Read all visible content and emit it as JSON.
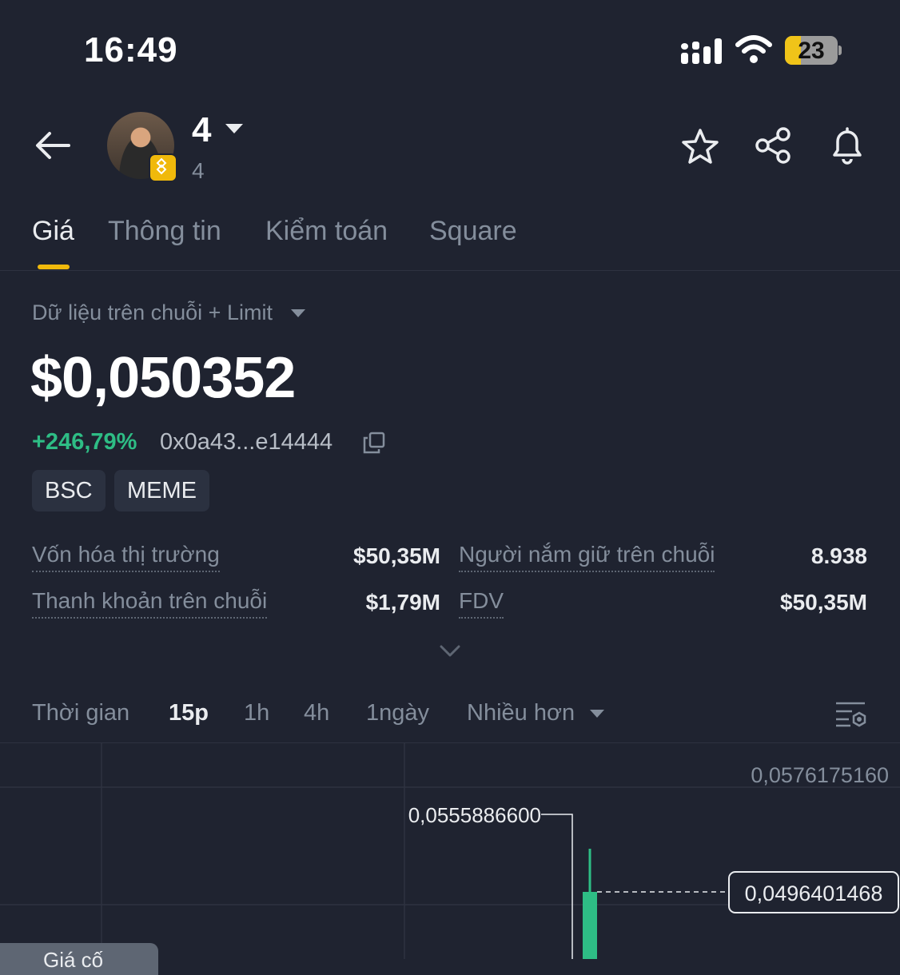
{
  "status_bar": {
    "time": "16:49",
    "battery": "23"
  },
  "header": {
    "token_name": "4",
    "token_subtitle": "4"
  },
  "tabs": [
    {
      "label": "Giá",
      "active": true
    },
    {
      "label": "Thông tin",
      "active": false
    },
    {
      "label": "Kiểm toán",
      "active": false
    },
    {
      "label": "Square",
      "active": false
    }
  ],
  "price_section": {
    "source": "Dữ liệu trên chuỗi + Limit",
    "price": "$0,050352",
    "change": "+246,79%",
    "address": "0x0a43...e14444",
    "tags": [
      "BSC",
      "MEME"
    ]
  },
  "stats": [
    {
      "label": "Vốn hóa thị trường",
      "value": "$50,35M"
    },
    {
      "label": "Người nắm giữ trên chuỗi",
      "value": "8.938"
    },
    {
      "label": "Thanh khoản trên chuỗi",
      "value": "$1,79M"
    },
    {
      "label": "FDV",
      "value": "$50,35M"
    }
  ],
  "timeframes": {
    "label": "Thời gian",
    "options": [
      "15p",
      "1h",
      "4h",
      "1ngày"
    ],
    "selected": "15p",
    "more": "Nhiều hơn"
  },
  "chart": {
    "price_labels": {
      "high_axis": "0,0576175160",
      "high_marker": "0,0555886600",
      "current": "0,0496401468"
    },
    "up_color": "#2ebd85"
  },
  "bottom_pill": {
    "label": "Giá cố"
  },
  "colors": {
    "accent": "#f0b90b",
    "positive": "#2ebd85",
    "background": "#1f2330"
  }
}
